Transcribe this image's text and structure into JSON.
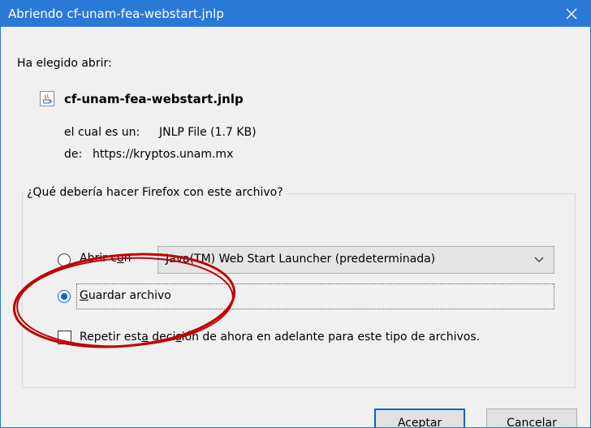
{
  "window": {
    "title": "Abriendo cf-unam-fea-webstart.jnlp",
    "close_symbol": "✕"
  },
  "dialog": {
    "intro": "Ha elegido abrir:",
    "file": {
      "icon": "java-file-icon",
      "name": "cf-unam-fea-webstart.jnlp",
      "type_label": "el cual es un:",
      "type_value": "JNLP File (1.7 KB)",
      "from_label": "de:",
      "from_value": "https://kryptos.unam.mx"
    },
    "question": "¿Qué debería hacer Firefox con este archivo?",
    "options": {
      "open_with": {
        "label_pre": "Abrir c",
        "label_mnemonic": "o",
        "label_post": "n",
        "selected": false
      },
      "app_select": {
        "value": "Java(TM) Web Start Launcher (predeterminada)"
      },
      "save_file": {
        "label_pre": "",
        "label_mnemonic": "G",
        "label_post": "uardar archivo",
        "selected": true
      }
    },
    "remember": {
      "label_pre": "Repetir est",
      "label_mnemonic": "a",
      "label_mid": " deci",
      "label_mnemonic2": "s",
      "label_post": "ión de ahora en adelante para este tipo de archivos.",
      "checked": false
    },
    "buttons": {
      "ok": "Aceptar",
      "cancel": "Cancelar"
    }
  },
  "colors": {
    "titlebar": "#2b79d7",
    "annotation_circle": "#c00000",
    "accent": "#0a64c8"
  }
}
